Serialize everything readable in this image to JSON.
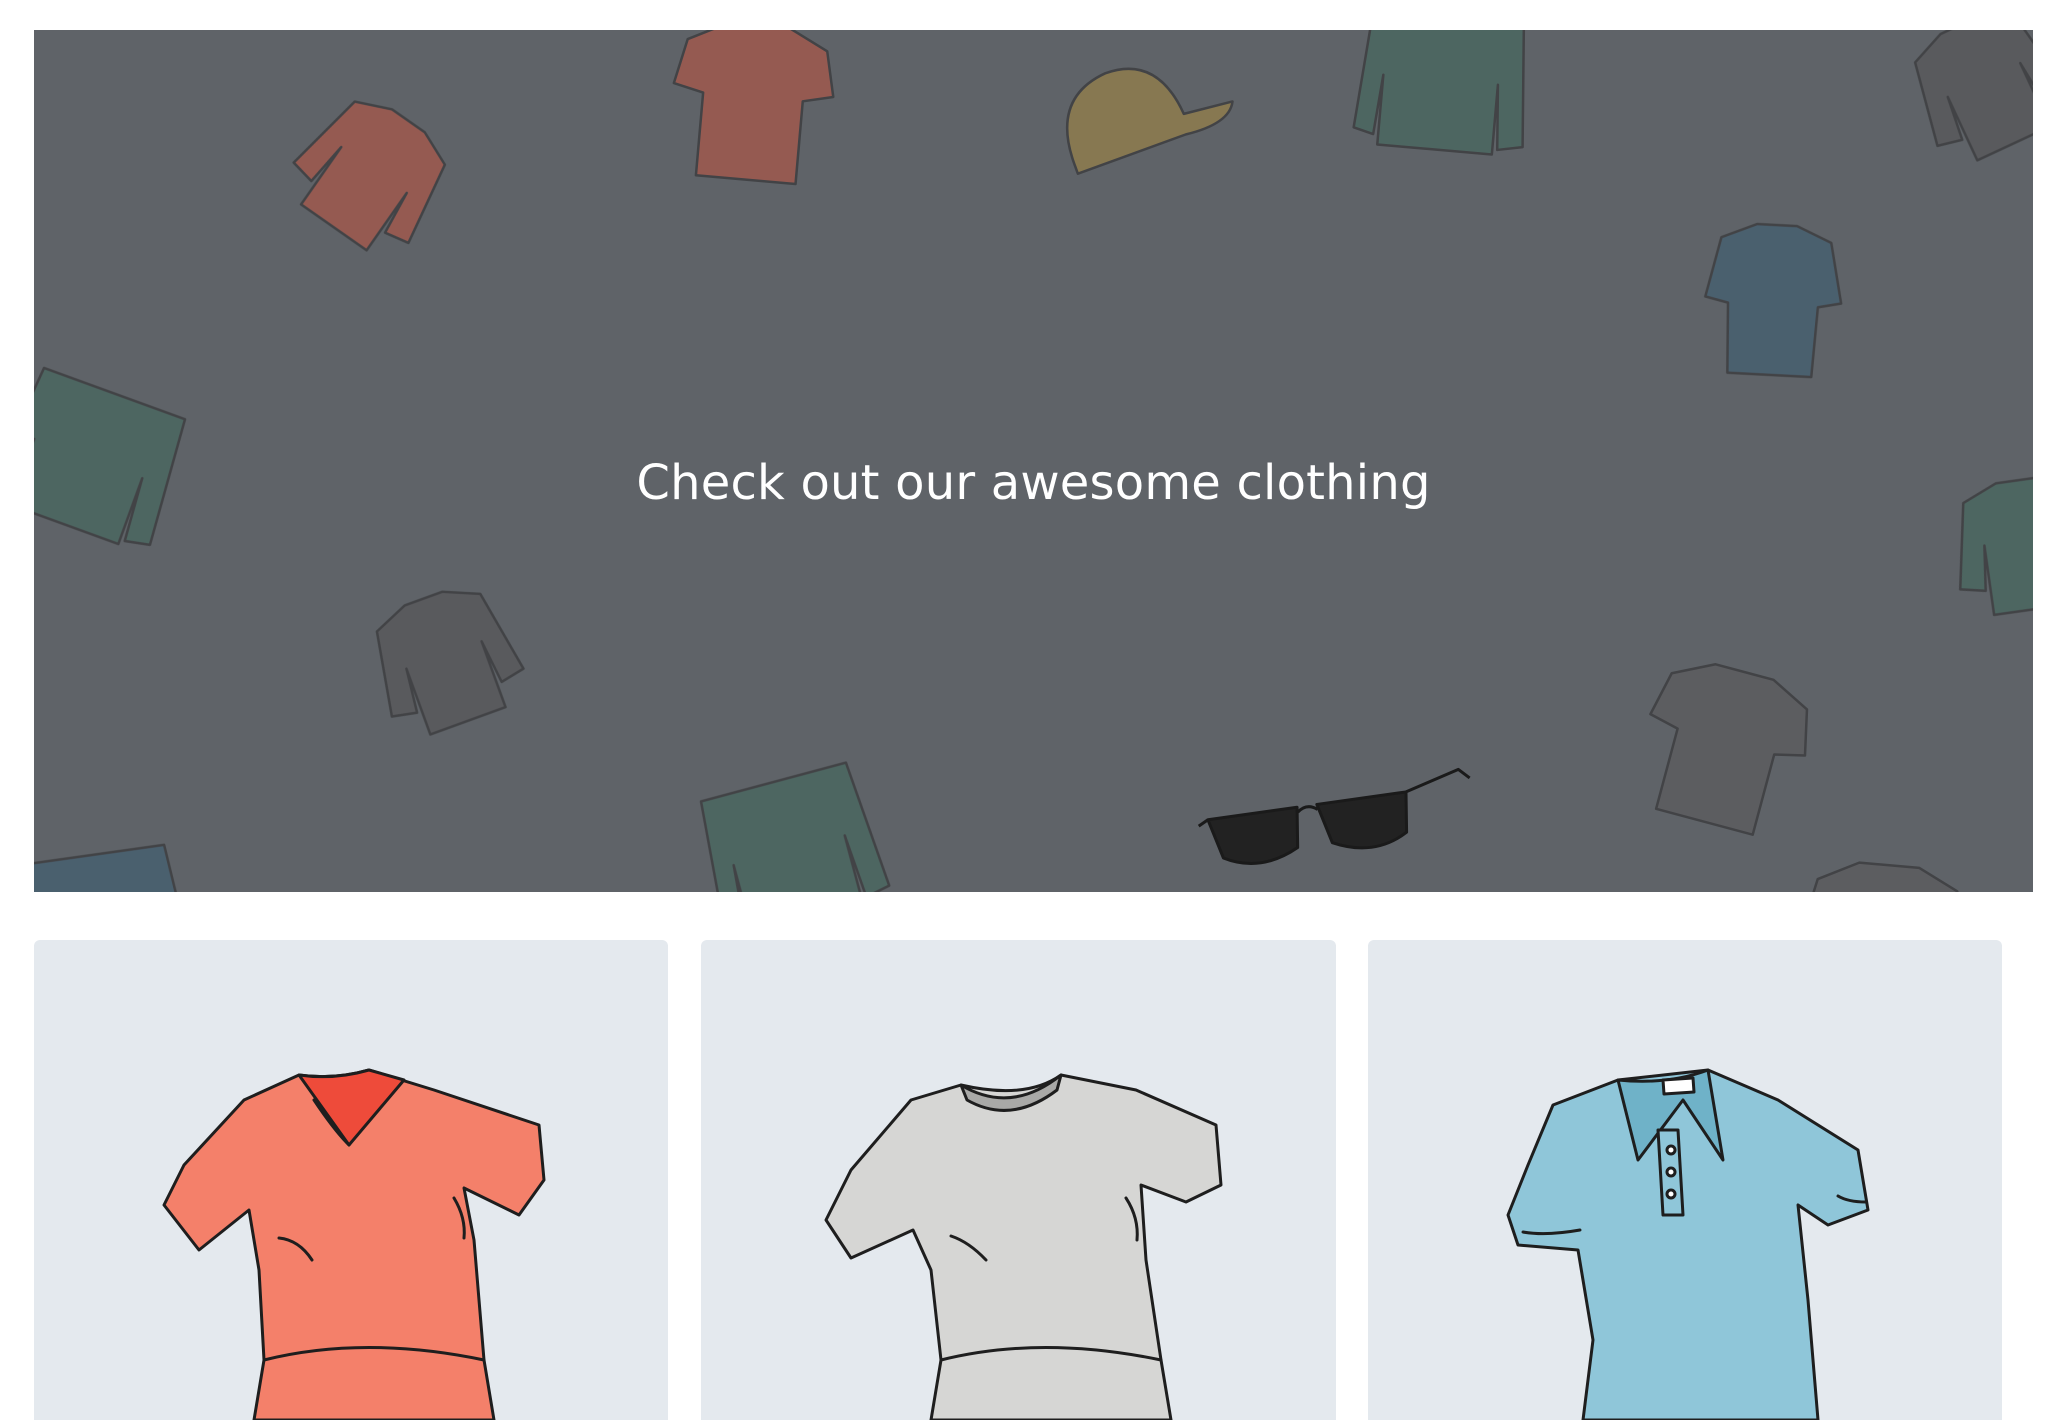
{
  "hero": {
    "title": "Check out our awesome clothing",
    "background_color": "#5f6368",
    "icons": [
      "hoodie-icon",
      "t-shirt-icon",
      "cap-icon",
      "jacket-icon",
      "polo-shirt-icon",
      "sunglasses-icon"
    ]
  },
  "products": [
    {
      "icon": "v-neck-t-shirt-icon",
      "color": "#f4806a"
    },
    {
      "icon": "crew-neck-t-shirt-icon",
      "color": "#d4d4d4"
    },
    {
      "icon": "polo-shirt-icon",
      "color": "#8fc6d9"
    }
  ],
  "colors": {
    "card_background": "#e4e9ee",
    "page_background": "#ffffff"
  }
}
